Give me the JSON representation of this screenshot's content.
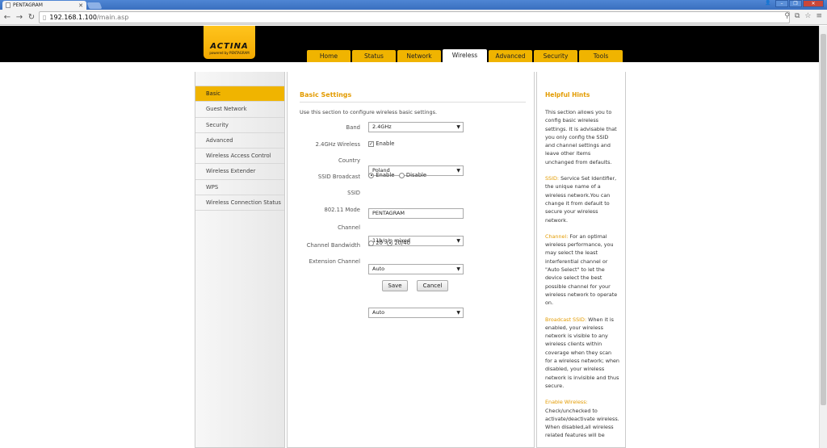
{
  "browser": {
    "tab_title": "PENTAGRAM",
    "url_host": "192.168.1.100",
    "url_path": "/main.asp"
  },
  "logo": {
    "brand": "ACTINA",
    "sub": "powered by PENTAGRAM"
  },
  "nav": {
    "tabs": [
      {
        "label": "Home"
      },
      {
        "label": "Status"
      },
      {
        "label": "Network"
      },
      {
        "label": "Wireless"
      },
      {
        "label": "Advanced"
      },
      {
        "label": "Security"
      },
      {
        "label": "Tools"
      }
    ]
  },
  "sidebar": {
    "items": [
      {
        "label": "Basic"
      },
      {
        "label": "Guest Network"
      },
      {
        "label": "Security"
      },
      {
        "label": "Advanced"
      },
      {
        "label": "Wireless Access Control"
      },
      {
        "label": "Wireless Extender"
      },
      {
        "label": "WPS"
      },
      {
        "label": "Wireless Connection Status"
      }
    ]
  },
  "main": {
    "title": "Basic Settings",
    "description": "Use this section to configure wireless basic settings.",
    "band": {
      "label": "Band",
      "value": "2.4GHz"
    },
    "wireless": {
      "label": "2.4GHz Wireless",
      "option": "Enable"
    },
    "country": {
      "label": "Country",
      "value": "Poland"
    },
    "ssid_broadcast": {
      "label": "SSID Broadcast",
      "enable": "Enable",
      "disable": "Disable"
    },
    "ssid": {
      "label": "SSID",
      "value": "PENTAGRAM"
    },
    "mode": {
      "label": "802.11 Mode",
      "value": "11b/g/n mixed"
    },
    "channel": {
      "label": "Channel",
      "value": "Auto"
    },
    "bandwidth": {
      "label": "Channel Bandwidth",
      "opt1": "20",
      "opt2": "20/40"
    },
    "ext_channel": {
      "label": "Extension Channel",
      "value": "Auto"
    },
    "save": "Save",
    "cancel": "Cancel"
  },
  "hints": {
    "title": "Helpful Hints",
    "intro": "This section allows you to config basic wireless settings. It is advisable that you only config the SSID and channel settings and leave other items unchanged from defaults.",
    "ssid_kw": "SSID:",
    "ssid_text": " Service Set Identifier, the unique name of a wireless network.You can change it from default to secure your wireless network.",
    "channel_kw": "Channel:",
    "channel_text": " For an optimal wireless performance, you may select the least interferential channel or \"Auto Select\" to let the device select the best possible channel for your wireless network to operate on.",
    "broadcast_kw": "Broadcast SSID:",
    "broadcast_text": " When it is enabled, your wireless network is visible to any wireless clients within coverage when they scan for a wireless network; when disabled, your wireless network is invisible and thus secure.",
    "enable_kw": "Enable Wireless:",
    "enable_text": "Check/unchecked to activate/deactivate wireless. When disabled,all wireless related features will be"
  }
}
